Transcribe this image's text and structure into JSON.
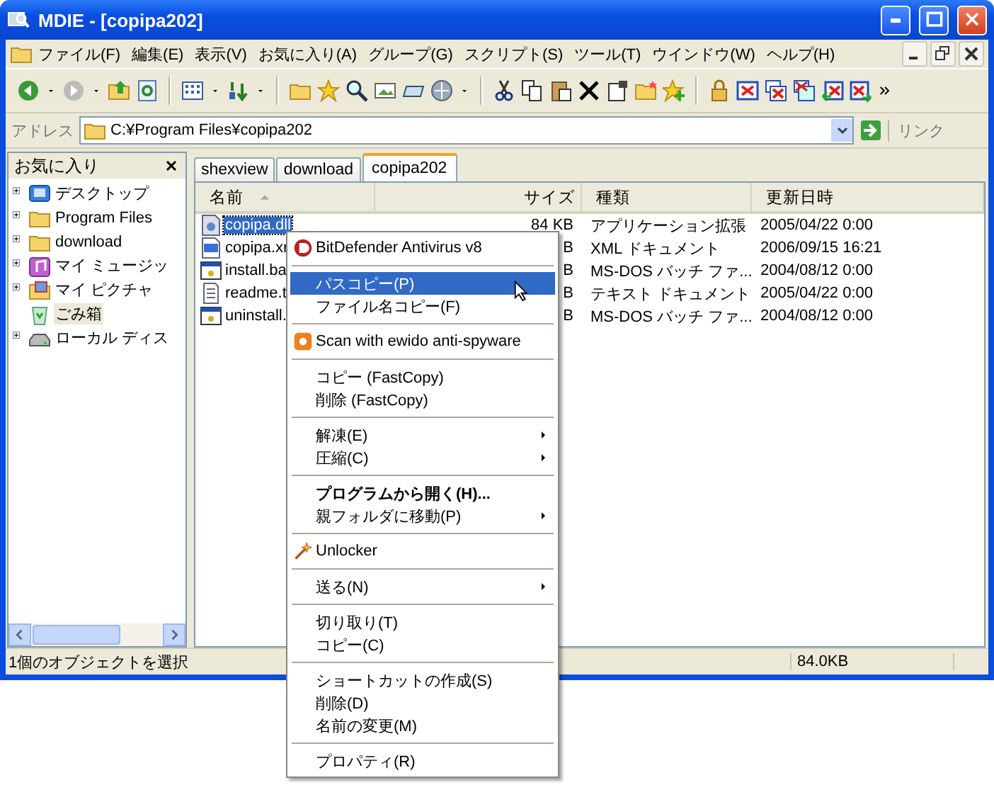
{
  "window": {
    "title": "MDIE - [copipa202]"
  },
  "menu_bar": [
    "ファイル(F)",
    "編集(E)",
    "表示(V)",
    "お気に入り(A)",
    "グループ(G)",
    "スクリプト(S)",
    "ツール(T)",
    "ウインドウ(W)",
    "ヘルプ(H)"
  ],
  "address_bar": {
    "label": "アドレス",
    "value": "C:¥Program Files¥copipa202",
    "links_label": "リンク"
  },
  "sidebar": {
    "title": "お気に入り",
    "tree": [
      {
        "label": "デスクトップ",
        "kind": "desktop",
        "expandable": true,
        "selected": false
      },
      {
        "label": "Program Files",
        "kind": "folder",
        "expandable": true,
        "selected": false
      },
      {
        "label": "download",
        "kind": "folder",
        "expandable": true,
        "selected": false
      },
      {
        "label": "マイ ミュージッ",
        "kind": "music",
        "expandable": true,
        "selected": false
      },
      {
        "label": "マイ ピクチャ",
        "kind": "pictures",
        "expandable": true,
        "selected": false
      },
      {
        "label": "ごみ箱",
        "kind": "trash",
        "expandable": false,
        "selected": true
      },
      {
        "label": "ローカル ディス",
        "kind": "drive",
        "expandable": true,
        "selected": false
      }
    ]
  },
  "tabs": [
    {
      "label": "shexview",
      "selected": false
    },
    {
      "label": "download",
      "selected": false
    },
    {
      "label": "copipa202",
      "selected": true
    }
  ],
  "columns": [
    {
      "label": "名前",
      "sorted": true
    },
    {
      "label": "サイズ",
      "sorted": false
    },
    {
      "label": "種類",
      "sorted": false
    },
    {
      "label": "更新日時",
      "sorted": false
    }
  ],
  "files": [
    {
      "name": "copipa.dll",
      "kind": "dll",
      "size": "84 KB",
      "type": "アプリケーション拡張",
      "modified": "2005/04/22 0:00",
      "selected": true
    },
    {
      "name": "copipa.xr",
      "kind": "xml",
      "size": "B",
      "type": "XML ドキュメント",
      "modified": "2006/09/15 16:21",
      "selected": false
    },
    {
      "name": "install.ba",
      "kind": "bat",
      "size": "B",
      "type": "MS-DOS バッチ ファ...",
      "modified": "2004/08/12 0:00",
      "selected": false
    },
    {
      "name": "readme.t",
      "kind": "txt",
      "size": "B",
      "type": "テキスト ドキュメント",
      "modified": "2005/04/22 0:00",
      "selected": false
    },
    {
      "name": "uninstall.",
      "kind": "bat",
      "size": "B",
      "type": "MS-DOS バッチ ファ...",
      "modified": "2004/08/12 0:00",
      "selected": false
    }
  ],
  "context_menu": [
    {
      "kind": "icon-item",
      "label": "BitDefender Antivirus v8",
      "bold": false,
      "submenu": false,
      "selected": false
    },
    {
      "kind": "separator"
    },
    {
      "kind": "item",
      "label": "パスコピー(P)",
      "bold": false,
      "submenu": false,
      "selected": true
    },
    {
      "kind": "item",
      "label": "ファイル名コピー(F)",
      "bold": false,
      "submenu": false,
      "selected": false
    },
    {
      "kind": "separator"
    },
    {
      "kind": "icon-item",
      "label": "Scan with ewido anti-spyware",
      "bold": false,
      "submenu": false,
      "selected": false
    },
    {
      "kind": "separator"
    },
    {
      "kind": "item",
      "label": "コピー (FastCopy)",
      "bold": false,
      "submenu": false,
      "selected": false
    },
    {
      "kind": "item",
      "label": "削除 (FastCopy)",
      "bold": false,
      "submenu": false,
      "selected": false
    },
    {
      "kind": "separator"
    },
    {
      "kind": "item",
      "label": "解凍(E)",
      "bold": false,
      "submenu": true,
      "selected": false
    },
    {
      "kind": "item",
      "label": "圧縮(C)",
      "bold": false,
      "submenu": true,
      "selected": false
    },
    {
      "kind": "separator"
    },
    {
      "kind": "item",
      "label": "プログラムから開く(H)...",
      "bold": true,
      "submenu": false,
      "selected": false
    },
    {
      "kind": "item",
      "label": "親フォルダに移動(P)",
      "bold": false,
      "submenu": true,
      "selected": false
    },
    {
      "kind": "separator"
    },
    {
      "kind": "icon-item",
      "label": "Unlocker",
      "bold": false,
      "submenu": false,
      "selected": false
    },
    {
      "kind": "separator"
    },
    {
      "kind": "item",
      "label": "送る(N)",
      "bold": false,
      "submenu": true,
      "selected": false
    },
    {
      "kind": "separator"
    },
    {
      "kind": "item",
      "label": "切り取り(T)",
      "bold": false,
      "submenu": false,
      "selected": false
    },
    {
      "kind": "item",
      "label": "コピー(C)",
      "bold": false,
      "submenu": false,
      "selected": false
    },
    {
      "kind": "separator"
    },
    {
      "kind": "item",
      "label": "ショートカットの作成(S)",
      "bold": false,
      "submenu": false,
      "selected": false
    },
    {
      "kind": "item",
      "label": "削除(D)",
      "bold": false,
      "submenu": false,
      "selected": false
    },
    {
      "kind": "item",
      "label": "名前の変更(M)",
      "bold": false,
      "submenu": false,
      "selected": false
    },
    {
      "kind": "separator"
    },
    {
      "kind": "item",
      "label": "プロパティ(R)",
      "bold": false,
      "submenu": false,
      "selected": false
    }
  ],
  "status_bar": {
    "message": "1個のオブジェクトを選択",
    "size": "84.0KB"
  }
}
